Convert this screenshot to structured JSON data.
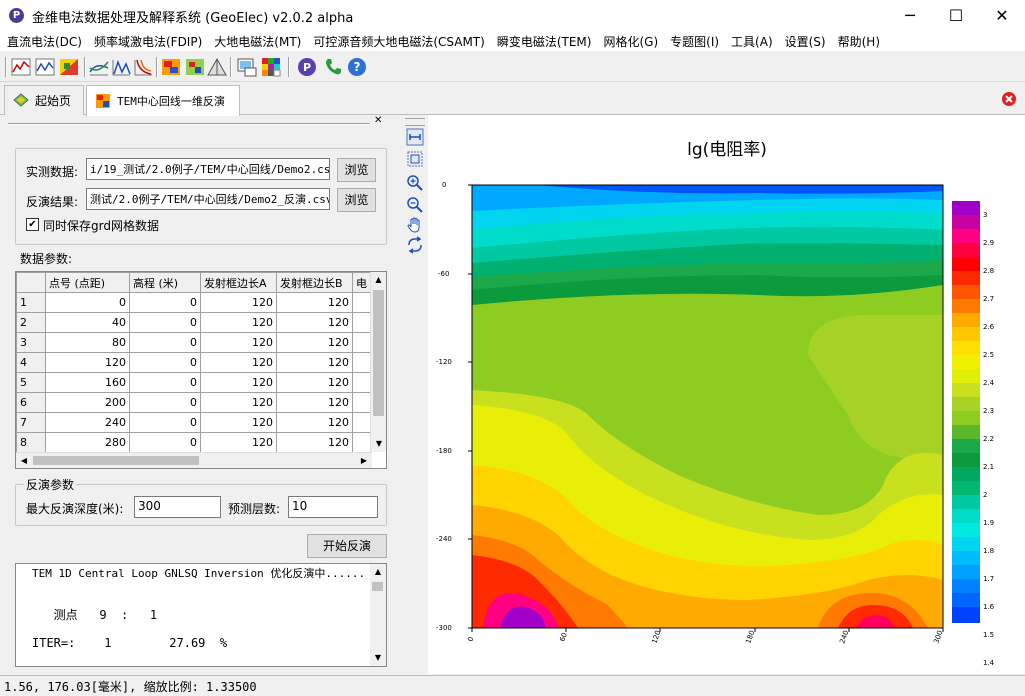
{
  "window": {
    "title": "金维电法数据处理及解释系统 (GeoElec)  v2.0.2 alpha",
    "icon_letter": "P",
    "min_glyph": "─",
    "max_glyph": "☐",
    "close_glyph": "✕"
  },
  "menu": [
    "直流电法(DC)",
    "频率域激电法(FDIP)",
    "大地电磁法(MT)",
    "可控源音频大地电磁法(CSAMT)",
    "瞬变电磁法(TEM)",
    "网格化(G)",
    "专题图(I)",
    "工具(A)",
    "设置(S)",
    "帮助(H)"
  ],
  "tabs": [
    {
      "label": "起始页"
    },
    {
      "label": "TEM中心回线一维反演"
    }
  ],
  "form": {
    "measured_label": "实测数据:",
    "measured_value": "i/19_测试/2.0例子/TEM/中心回线/Demo2.csv",
    "result_label": "反演结果:",
    "result_value": "测试/2.0例子/TEM/中心回线/Demo2_反演.csv",
    "browse": "浏览",
    "save_grd_label": "同时保存grd网格数据",
    "save_grd_check": "✔",
    "params_title": "数据参数:",
    "inversion_group_title": "反演参数",
    "max_depth_label": "最大反演深度(米):",
    "max_depth_value": "300",
    "layers_label": "预测层数:",
    "layers_value": "10",
    "start_button": "开始反演"
  },
  "table": {
    "headers": [
      "点号 (点距)",
      "高程 (米)",
      "发射框边长A",
      "发射框边长B",
      "电"
    ],
    "rows": [
      [
        "1",
        "0",
        "0",
        "120",
        "120"
      ],
      [
        "2",
        "40",
        "0",
        "120",
        "120"
      ],
      [
        "3",
        "80",
        "0",
        "120",
        "120"
      ],
      [
        "4",
        "120",
        "0",
        "120",
        "120"
      ],
      [
        "5",
        "160",
        "0",
        "120",
        "120"
      ],
      [
        "6",
        "200",
        "0",
        "120",
        "120"
      ],
      [
        "7",
        "240",
        "0",
        "120",
        "120"
      ],
      [
        "8",
        "280",
        "0",
        "120",
        "120"
      ]
    ]
  },
  "log": {
    "line1": "TEM 1D Central Loop GNLSQ Inversion 优化反演中......",
    "line2": "   测点   9  :   1",
    "line3": "ITER=:    1        27.69  %"
  },
  "plot": {
    "title": "lg(电阻率)",
    "y_ticks": [
      "0",
      "-60",
      "-120",
      "-180",
      "-240",
      "-300"
    ],
    "x_ticks": [
      "0",
      "60",
      "120",
      "180",
      "240",
      "300"
    ],
    "colorbar_labels": [
      "3",
      "2.9",
      "2.8",
      "2.7",
      "2.6",
      "2.5",
      "2.4",
      "2.3",
      "2.2",
      "2.1",
      "2",
      "1.9",
      "1.8",
      "1.7",
      "1.6",
      "1.5",
      "1.4"
    ]
  },
  "status": "1.56, 176.03[毫米], 缩放比例: 1.33500"
}
